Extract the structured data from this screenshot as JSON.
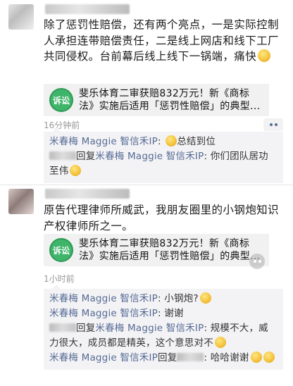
{
  "posts": [
    {
      "text": "除了惩罚性赔偿，还有两个亮点，一是实际控制人承担连带赔偿责任，二是线上网店和线下工厂共同侵权。台前幕后线上线下一锅端，痛快",
      "emoji": "grin-emoji",
      "card": {
        "icon_label": "诉讼",
        "title": "斐乐体育二审获赔832万元！新《商标法》实施后适用「惩罚性赔偿」的典型..."
      },
      "time": "16分钟前",
      "comments": [
        {
          "nick": "米春梅 Maggie 智信禾IP",
          "sep": ": ",
          "text": "总结到位",
          "emoji": "thumbs-up-emoji"
        },
        {
          "prefix": "回复",
          "nick": "米春梅 Maggie 智信禾IP",
          "sep": ": ",
          "text": "你们团队居功至伟",
          "emoji": "thumbs-up-emoji"
        }
      ]
    },
    {
      "text": "原告代理律师所威武，我朋友圈里的小钢炮知识产权律师所之一。",
      "card": {
        "icon_label": "诉讼",
        "title": "斐乐体育二审获赔832万元！新《商标法》实施后适用「惩罚性赔偿」的典型..."
      },
      "time": "1小时前",
      "comments": [
        {
          "nick": "米春梅 Maggie 智信禾IP",
          "sep": ": ",
          "text": "小钢炮?",
          "emoji": "smile-emoji"
        },
        {
          "nick": "米春梅 Maggie 智信禾IP",
          "sep": ": ",
          "text": "谢谢"
        },
        {
          "prefix": "回复",
          "nick": "米春梅 Maggie 智信禾IP",
          "sep": ": ",
          "text": "规模不大，威力很大，成员都是精英，这个意思对不",
          "emoji": "grin-emoji"
        },
        {
          "nick": "米春梅 Maggie 智信禾IP",
          "prefix2": "回复",
          "sep": ": ",
          "text": "哈哈谢谢",
          "emoji": "laugh-emoji",
          "emoji2": "laugh-emoji"
        }
      ]
    }
  ]
}
